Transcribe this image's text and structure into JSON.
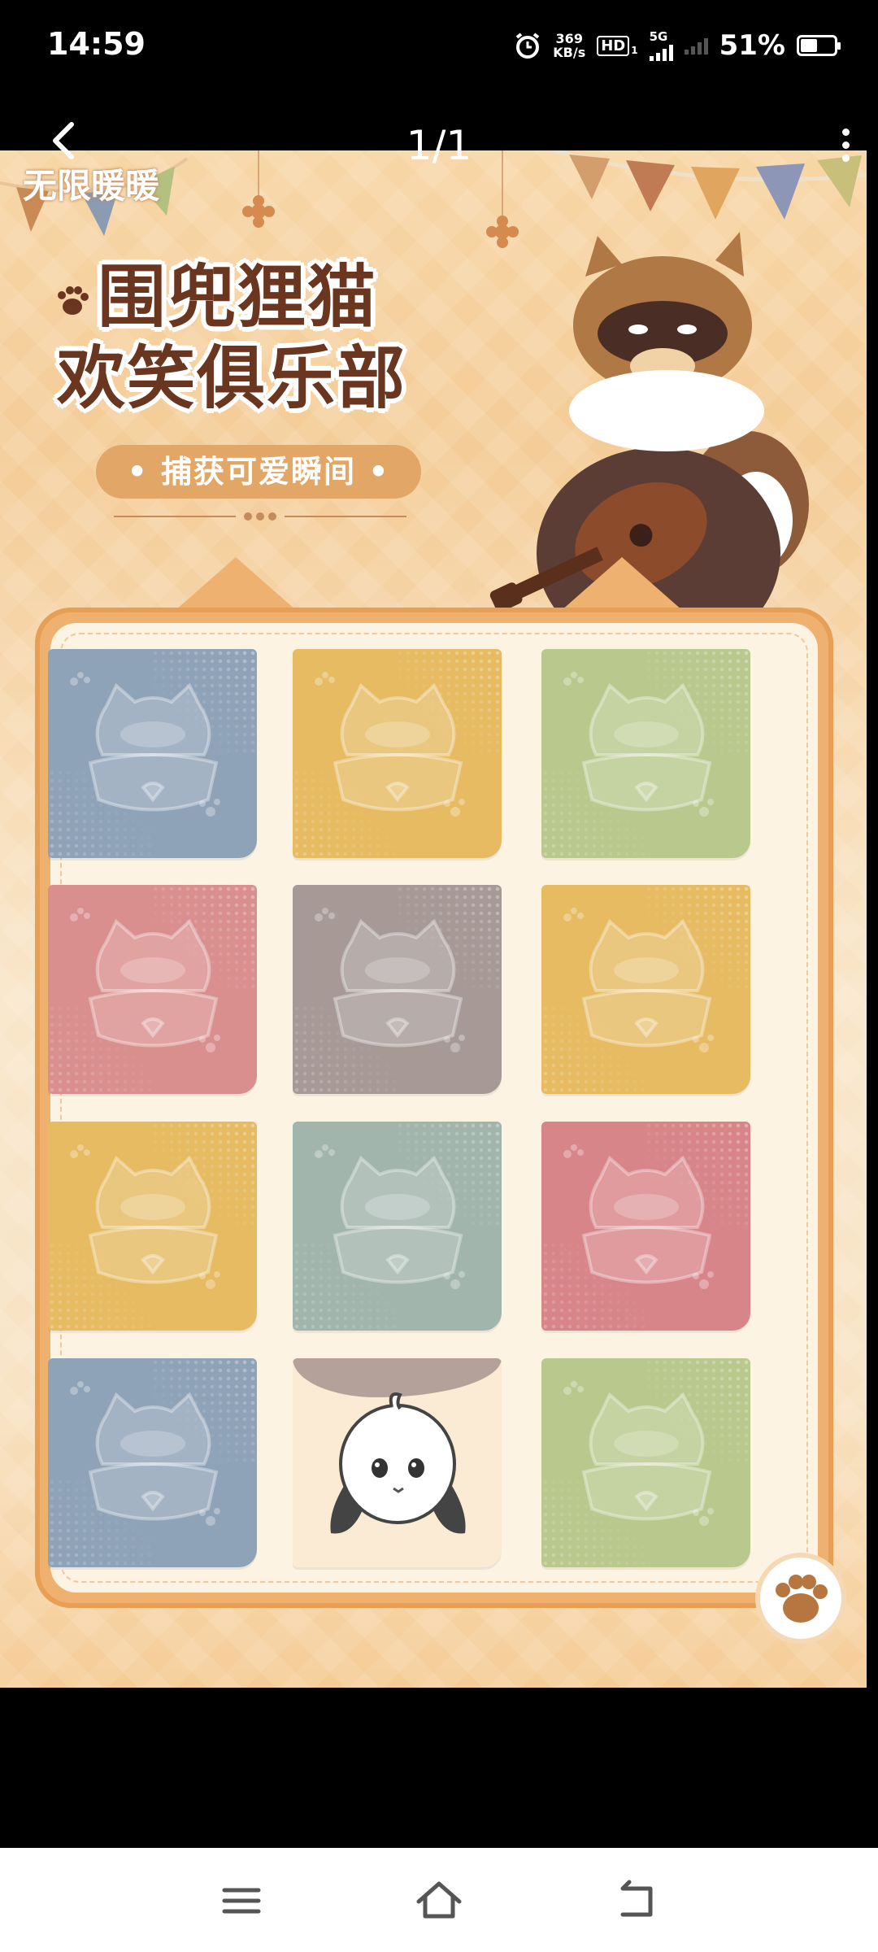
{
  "status_bar": {
    "time": "14:59",
    "network_speed_value": "369",
    "network_speed_unit": "KB/s",
    "hd_badge": "HD",
    "hd_sub": "1",
    "network_type": "5G",
    "battery_percent": "51%",
    "battery_level": 0.51
  },
  "viewer": {
    "counter": "1/1"
  },
  "poster": {
    "logo_text": "无限暖暖",
    "title_line1": "围兜狸猫",
    "title_line2": "欢笑俱乐部",
    "subtitle": "• 捕获可爱瞬间 •",
    "cards": [
      {
        "color": "#8fa3b8",
        "state": "hidden"
      },
      {
        "color": "#e6bb62",
        "state": "hidden"
      },
      {
        "color": "#b9c98d",
        "state": "hidden"
      },
      {
        "color": "#d98f8e",
        "state": "hidden"
      },
      {
        "color": "#a79a96",
        "state": "hidden"
      },
      {
        "color": "#e6bb62",
        "state": "hidden"
      },
      {
        "color": "#e6bb62",
        "state": "hidden"
      },
      {
        "color": "#a2b5ac",
        "state": "hidden"
      },
      {
        "color": "#d88589",
        "state": "hidden"
      },
      {
        "color": "#8fa3b8",
        "state": "hidden"
      },
      {
        "color": "#fbebd4",
        "state": "revealed",
        "character": "white-bunny"
      },
      {
        "color": "#b9c98d",
        "state": "hidden"
      }
    ]
  },
  "nav_bar": {
    "menu_icon": "menu-icon",
    "home_icon": "home-icon",
    "back_icon": "back-icon"
  }
}
